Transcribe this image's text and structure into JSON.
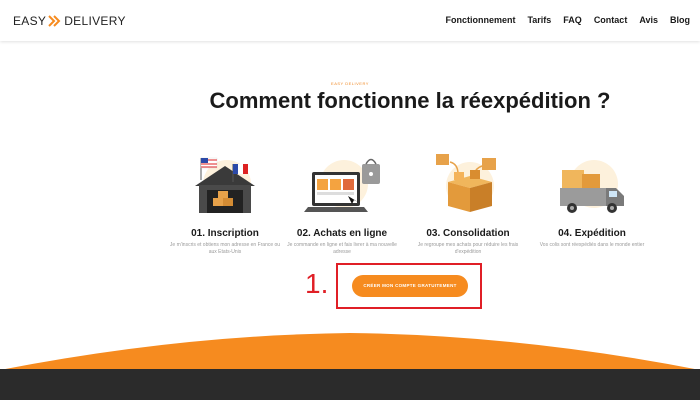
{
  "brand": {
    "left": "EASY",
    "right": "DELIVERY",
    "accent": "#f68b1f"
  },
  "nav": {
    "items": [
      "Fonctionnement",
      "Tarifs",
      "FAQ",
      "Contact",
      "Avis",
      "Blog"
    ]
  },
  "hero": {
    "eyebrow": "EASY DELIVERY",
    "title": "Comment fonctionne la réexpédition ?"
  },
  "steps": [
    {
      "title": "01. Inscription",
      "desc": "Je m'inscris et obtiens mon adresse en France ou aux Etats-Unis",
      "icon": "house-flags-icon"
    },
    {
      "title": "02. Achats en ligne",
      "desc": "Je commande en ligne et fais livrer à ma nouvelle adresse",
      "icon": "laptop-shopping-icon"
    },
    {
      "title": "03. Consolidation",
      "desc": "Je regroupe mes achats pour réduire les frais d'expédition",
      "icon": "boxes-consolidation-icon"
    },
    {
      "title": "04. Expédition",
      "desc": "Vos colis sont réexpédiés dans le monde entier",
      "icon": "delivery-truck-icon"
    }
  ],
  "cta": {
    "label": "CRÉER MON COMPTE GRATUITEMENT"
  },
  "annotation": {
    "label": "1."
  },
  "colors": {
    "orange": "#f68b1f",
    "annotation_red": "#e01f26",
    "footer": "#2b2b2b"
  }
}
